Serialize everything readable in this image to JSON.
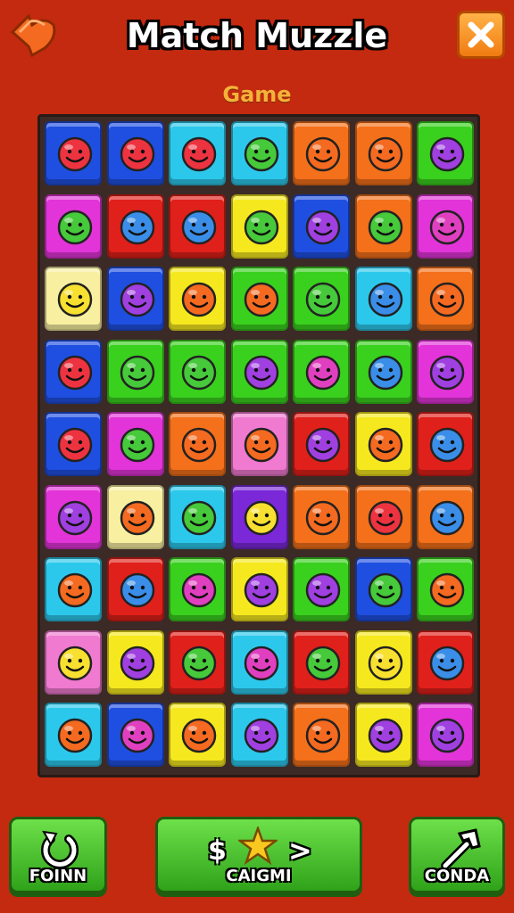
{
  "header": {
    "title": "Match Muzzle",
    "subtitle": "Game",
    "back_icon": "heart-arrow-icon",
    "close_icon": "close-icon"
  },
  "board": {
    "rows": 9,
    "cols": 7,
    "tile_colors": {
      "blue": "#1f4fe0",
      "cyan": "#2cc8ec",
      "orange": "#f4701a",
      "green": "#3ad01e",
      "magenta": "#e234d8",
      "red": "#e0201a",
      "yellow": "#f6e81e",
      "purple": "#7a28d8",
      "pink": "#f07ad0",
      "cream": "#f8f0a0"
    },
    "tiles": [
      [
        "blue",
        "blue",
        "cyan",
        "cyan",
        "orange",
        "orange",
        "green"
      ],
      [
        "magenta",
        "red",
        "red",
        "yellow",
        "blue",
        "orange",
        "magenta"
      ],
      [
        "cream",
        "blue",
        "yellow",
        "green",
        "green",
        "cyan",
        "orange"
      ],
      [
        "blue",
        "green",
        "green",
        "green",
        "green",
        "green",
        "magenta"
      ],
      [
        "blue",
        "magenta",
        "orange",
        "pink",
        "red",
        "yellow",
        "red"
      ],
      [
        "magenta",
        "cream",
        "cyan",
        "purple",
        "orange",
        "orange",
        "orange"
      ],
      [
        "cyan",
        "red",
        "green",
        "yellow",
        "green",
        "blue",
        "green"
      ],
      [
        "pink",
        "yellow",
        "red",
        "cyan",
        "red",
        "yellow",
        "red"
      ],
      [
        "cyan",
        "blue",
        "yellow",
        "cyan",
        "orange",
        "yellow",
        "magenta"
      ]
    ],
    "faces": [
      [
        "red",
        "red",
        "red",
        "green",
        "orange",
        "orange",
        "purple"
      ],
      [
        "green",
        "blue",
        "blue",
        "green",
        "purple",
        "green",
        "magenta"
      ],
      [
        "yellow",
        "purple",
        "orange",
        "orange",
        "green",
        "blue",
        "orange"
      ],
      [
        "red",
        "green",
        "green",
        "purple",
        "magenta",
        "blue",
        "purple"
      ],
      [
        "red",
        "green",
        "orange",
        "orange",
        "purple",
        "orange",
        "blue"
      ],
      [
        "purple",
        "orange",
        "green",
        "yellow",
        "orange",
        "red",
        "blue"
      ],
      [
        "orange",
        "blue",
        "magenta",
        "purple",
        "purple",
        "green",
        "orange"
      ],
      [
        "yellow",
        "purple",
        "green",
        "magenta",
        "green",
        "yellow",
        "blue"
      ],
      [
        "orange",
        "magenta",
        "orange",
        "purple",
        "orange",
        "purple",
        "purple"
      ]
    ],
    "face_colors": {
      "red": "#ee3340",
      "green": "#46c93a",
      "orange": "#f46a20",
      "purple": "#a040e0",
      "blue": "#3a8ee8",
      "yellow": "#f8e030",
      "magenta": "#e040c0"
    }
  },
  "controls": {
    "left_label": "FOINN",
    "left_icon": "restart-icon",
    "center_label": "CAIGMI",
    "center_icon": "star-icon",
    "center_prefix": "$",
    "center_suffix": ">",
    "right_label": "CONDA",
    "right_icon": "hammer-icon"
  }
}
